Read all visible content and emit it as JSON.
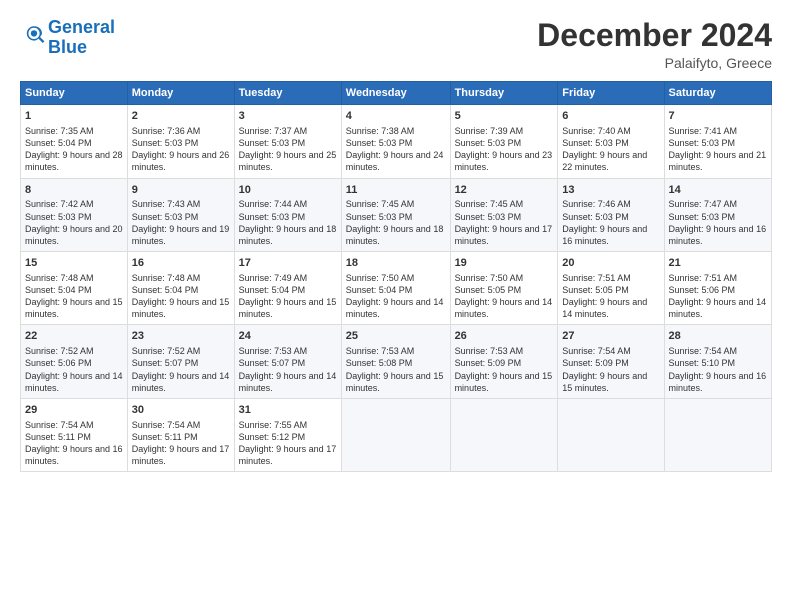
{
  "header": {
    "logo_general": "General",
    "logo_blue": "Blue",
    "month": "December 2024",
    "location": "Palaifyto, Greece"
  },
  "weekdays": [
    "Sunday",
    "Monday",
    "Tuesday",
    "Wednesday",
    "Thursday",
    "Friday",
    "Saturday"
  ],
  "weeks": [
    [
      {
        "day": "1",
        "info": "Sunrise: 7:35 AM\nSunset: 5:04 PM\nDaylight: 9 hours and 28 minutes."
      },
      {
        "day": "2",
        "info": "Sunrise: 7:36 AM\nSunset: 5:03 PM\nDaylight: 9 hours and 26 minutes."
      },
      {
        "day": "3",
        "info": "Sunrise: 7:37 AM\nSunset: 5:03 PM\nDaylight: 9 hours and 25 minutes."
      },
      {
        "day": "4",
        "info": "Sunrise: 7:38 AM\nSunset: 5:03 PM\nDaylight: 9 hours and 24 minutes."
      },
      {
        "day": "5",
        "info": "Sunrise: 7:39 AM\nSunset: 5:03 PM\nDaylight: 9 hours and 23 minutes."
      },
      {
        "day": "6",
        "info": "Sunrise: 7:40 AM\nSunset: 5:03 PM\nDaylight: 9 hours and 22 minutes."
      },
      {
        "day": "7",
        "info": "Sunrise: 7:41 AM\nSunset: 5:03 PM\nDaylight: 9 hours and 21 minutes."
      }
    ],
    [
      {
        "day": "8",
        "info": "Sunrise: 7:42 AM\nSunset: 5:03 PM\nDaylight: 9 hours and 20 minutes."
      },
      {
        "day": "9",
        "info": "Sunrise: 7:43 AM\nSunset: 5:03 PM\nDaylight: 9 hours and 19 minutes."
      },
      {
        "day": "10",
        "info": "Sunrise: 7:44 AM\nSunset: 5:03 PM\nDaylight: 9 hours and 18 minutes."
      },
      {
        "day": "11",
        "info": "Sunrise: 7:45 AM\nSunset: 5:03 PM\nDaylight: 9 hours and 18 minutes."
      },
      {
        "day": "12",
        "info": "Sunrise: 7:45 AM\nSunset: 5:03 PM\nDaylight: 9 hours and 17 minutes."
      },
      {
        "day": "13",
        "info": "Sunrise: 7:46 AM\nSunset: 5:03 PM\nDaylight: 9 hours and 16 minutes."
      },
      {
        "day": "14",
        "info": "Sunrise: 7:47 AM\nSunset: 5:03 PM\nDaylight: 9 hours and 16 minutes."
      }
    ],
    [
      {
        "day": "15",
        "info": "Sunrise: 7:48 AM\nSunset: 5:04 PM\nDaylight: 9 hours and 15 minutes."
      },
      {
        "day": "16",
        "info": "Sunrise: 7:48 AM\nSunset: 5:04 PM\nDaylight: 9 hours and 15 minutes."
      },
      {
        "day": "17",
        "info": "Sunrise: 7:49 AM\nSunset: 5:04 PM\nDaylight: 9 hours and 15 minutes."
      },
      {
        "day": "18",
        "info": "Sunrise: 7:50 AM\nSunset: 5:04 PM\nDaylight: 9 hours and 14 minutes."
      },
      {
        "day": "19",
        "info": "Sunrise: 7:50 AM\nSunset: 5:05 PM\nDaylight: 9 hours and 14 minutes."
      },
      {
        "day": "20",
        "info": "Sunrise: 7:51 AM\nSunset: 5:05 PM\nDaylight: 9 hours and 14 minutes."
      },
      {
        "day": "21",
        "info": "Sunrise: 7:51 AM\nSunset: 5:06 PM\nDaylight: 9 hours and 14 minutes."
      }
    ],
    [
      {
        "day": "22",
        "info": "Sunrise: 7:52 AM\nSunset: 5:06 PM\nDaylight: 9 hours and 14 minutes."
      },
      {
        "day": "23",
        "info": "Sunrise: 7:52 AM\nSunset: 5:07 PM\nDaylight: 9 hours and 14 minutes."
      },
      {
        "day": "24",
        "info": "Sunrise: 7:53 AM\nSunset: 5:07 PM\nDaylight: 9 hours and 14 minutes."
      },
      {
        "day": "25",
        "info": "Sunrise: 7:53 AM\nSunset: 5:08 PM\nDaylight: 9 hours and 15 minutes."
      },
      {
        "day": "26",
        "info": "Sunrise: 7:53 AM\nSunset: 5:09 PM\nDaylight: 9 hours and 15 minutes."
      },
      {
        "day": "27",
        "info": "Sunrise: 7:54 AM\nSunset: 5:09 PM\nDaylight: 9 hours and 15 minutes."
      },
      {
        "day": "28",
        "info": "Sunrise: 7:54 AM\nSunset: 5:10 PM\nDaylight: 9 hours and 16 minutes."
      }
    ],
    [
      {
        "day": "29",
        "info": "Sunrise: 7:54 AM\nSunset: 5:11 PM\nDaylight: 9 hours and 16 minutes."
      },
      {
        "day": "30",
        "info": "Sunrise: 7:54 AM\nSunset: 5:11 PM\nDaylight: 9 hours and 17 minutes."
      },
      {
        "day": "31",
        "info": "Sunrise: 7:55 AM\nSunset: 5:12 PM\nDaylight: 9 hours and 17 minutes."
      },
      null,
      null,
      null,
      null
    ]
  ]
}
